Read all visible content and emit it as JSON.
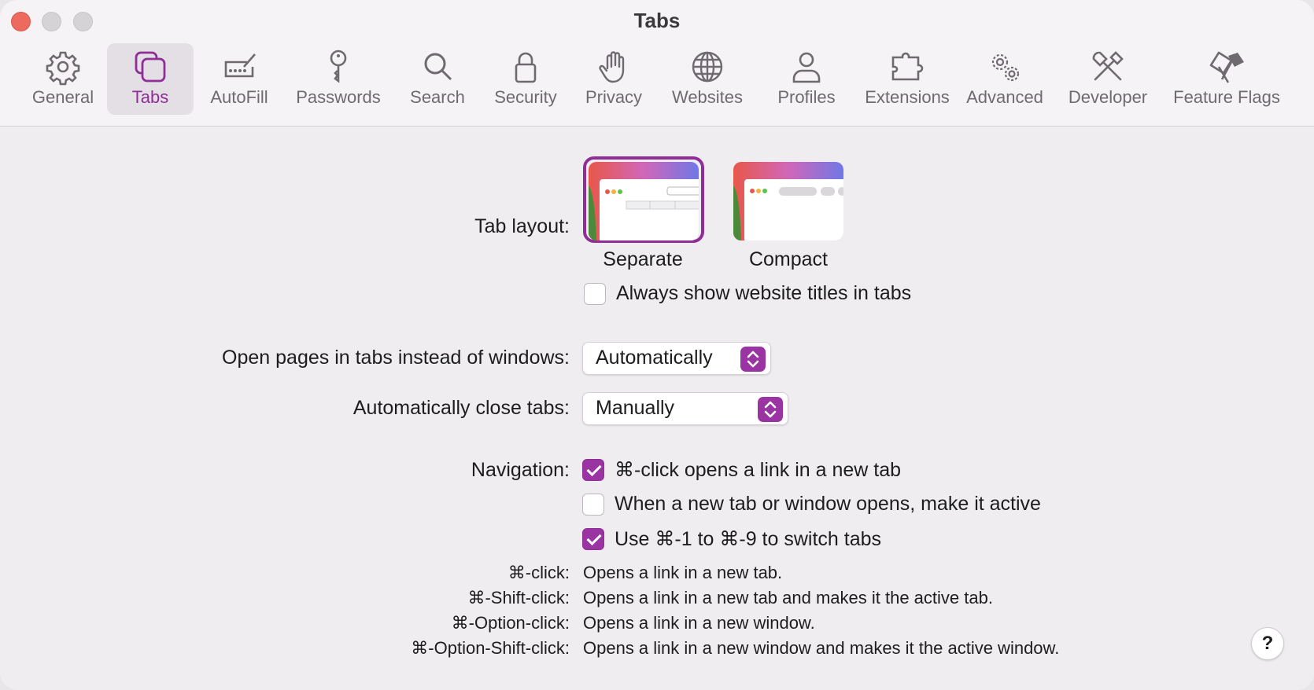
{
  "window": {
    "title": "Tabs"
  },
  "toolbar": {
    "items": [
      {
        "label": "General",
        "icon": "gear-icon"
      },
      {
        "label": "Tabs",
        "icon": "tabs-icon",
        "active": true
      },
      {
        "label": "AutoFill",
        "icon": "autofill-icon"
      },
      {
        "label": "Passwords",
        "icon": "key-icon"
      },
      {
        "label": "Search",
        "icon": "search-icon"
      },
      {
        "label": "Security",
        "icon": "lock-icon"
      },
      {
        "label": "Privacy",
        "icon": "hand-icon"
      },
      {
        "label": "Websites",
        "icon": "globe-icon"
      },
      {
        "label": "Profiles",
        "icon": "person-icon"
      },
      {
        "label": "Extensions",
        "icon": "puzzle-icon"
      },
      {
        "label": "Advanced",
        "icon": "gears-icon"
      },
      {
        "label": "Developer",
        "icon": "tools-icon"
      },
      {
        "label": "Feature Flags",
        "icon": "flags-icon"
      }
    ]
  },
  "tab_layout": {
    "label": "Tab layout:",
    "options": [
      {
        "caption": "Separate",
        "selected": true
      },
      {
        "caption": "Compact",
        "selected": false
      }
    ],
    "always_show_titles": {
      "label": "Always show website titles in tabs",
      "checked": false
    }
  },
  "open_pages": {
    "label": "Open pages in tabs instead of windows:",
    "value": "Automatically"
  },
  "close_tabs": {
    "label": "Automatically close tabs:",
    "value": "Manually"
  },
  "navigation": {
    "label": "Navigation:",
    "options": [
      {
        "label": "⌘-click opens a link in a new tab",
        "checked": true
      },
      {
        "label": "When a new tab or window opens, make it active",
        "checked": false
      },
      {
        "label": "Use ⌘-1 to ⌘-9 to switch tabs",
        "checked": true
      }
    ]
  },
  "shortcuts": [
    {
      "key": "⌘-click:",
      "desc": "Opens a link in a new tab."
    },
    {
      "key": "⌘-Shift-click:",
      "desc": "Opens a link in a new tab and makes it the active tab."
    },
    {
      "key": "⌘-Option-click:",
      "desc": "Opens a link in a new window."
    },
    {
      "key": "⌘-Option-Shift-click:",
      "desc": "Opens a link in a new window and makes it the active window."
    }
  ],
  "help": {
    "label": "?"
  },
  "colors": {
    "accent": "#9b34a3",
    "close_button": "#ed6a5e"
  }
}
